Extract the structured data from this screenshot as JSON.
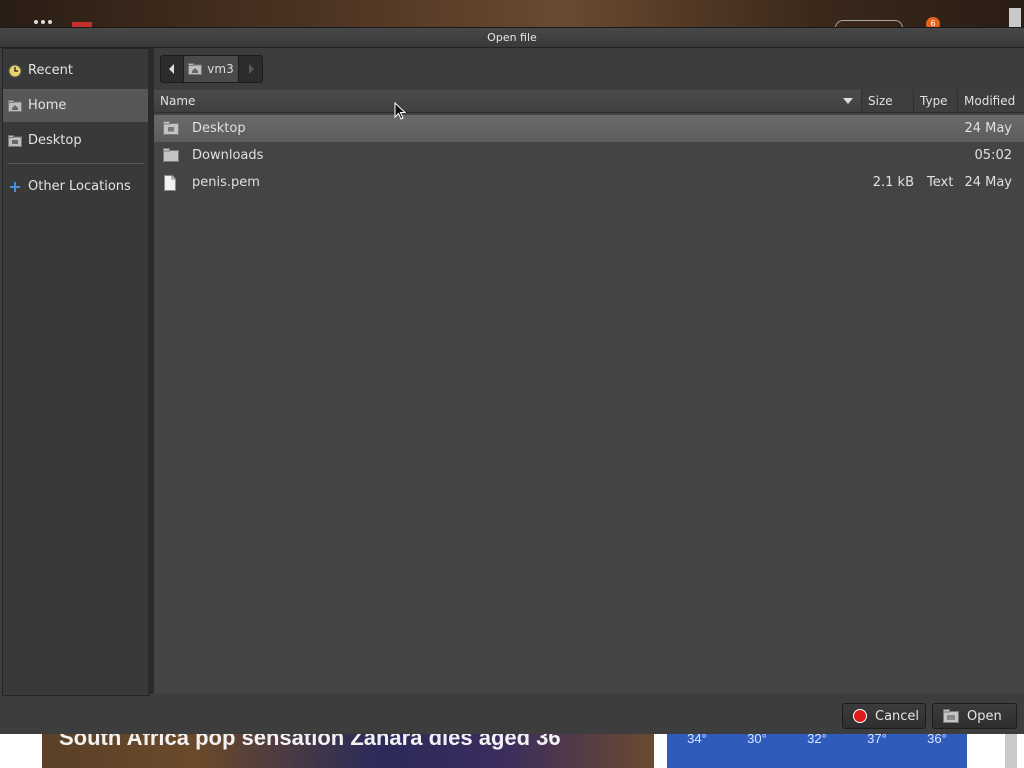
{
  "background": {
    "notification_count": "6",
    "headline": "South Africa pop sensation Zahara dies aged 36",
    "weather_temps": [
      "34°",
      "30°",
      "32°",
      "37°",
      "36°"
    ]
  },
  "dialog": {
    "title": "Open file",
    "sidebar": {
      "items": [
        {
          "label": "Recent",
          "icon": "clock-icon"
        },
        {
          "label": "Home",
          "icon": "home-folder-icon"
        },
        {
          "label": "Desktop",
          "icon": "desktop-folder-icon"
        },
        {
          "label": "Other Locations",
          "icon": "plus-icon"
        }
      ]
    },
    "pathbar": {
      "current": "vm3"
    },
    "columns": {
      "name": "Name",
      "size": "Size",
      "type": "Type",
      "modified": "Modified"
    },
    "files": [
      {
        "name": "Desktop",
        "size": "",
        "type": "",
        "modified": "24 May",
        "icon": "desktop-folder-icon",
        "selected": true
      },
      {
        "name": "Downloads",
        "size": "",
        "type": "",
        "modified": "05:02",
        "icon": "folder-icon",
        "selected": false
      },
      {
        "name": "penis.pem",
        "size": "2.1 kB",
        "type": "Text",
        "modified": "24 May",
        "icon": "text-file-icon",
        "selected": false
      }
    ],
    "buttons": {
      "cancel": "Cancel",
      "open": "Open"
    }
  },
  "colors": {
    "dialog_bg": "#3d3d3d",
    "list_bg": "#444444",
    "selection": "#626262",
    "cancel_icon": "#e01b1b"
  }
}
